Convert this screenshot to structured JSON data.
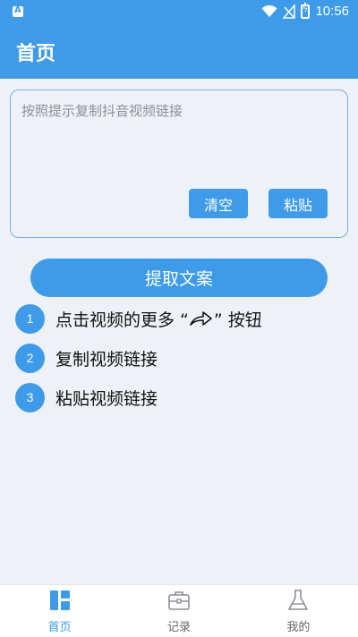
{
  "status_bar": {
    "time": "10:56",
    "app_icon": "A"
  },
  "app_bar": {
    "title": "首页"
  },
  "input": {
    "placeholder": "按照提示复制抖音视频链接",
    "value": ""
  },
  "buttons": {
    "clear": "清空",
    "paste": "粘贴",
    "extract": "提取文案"
  },
  "steps": [
    {
      "number": "1",
      "text_before": "点击视频的更多 “",
      "icon": "share-arrow-icon",
      "text_after": "” 按钮"
    },
    {
      "number": "2",
      "text": "复制视频链接"
    },
    {
      "number": "3",
      "text": "粘贴视频链接"
    }
  ],
  "bottom_nav": {
    "items": [
      {
        "label": "首页",
        "icon": "home-grid-icon",
        "active": true
      },
      {
        "label": "记录",
        "icon": "briefcase-icon",
        "active": false
      },
      {
        "label": "我的",
        "icon": "flask-icon",
        "active": false
      }
    ]
  },
  "colors": {
    "primary": "#3d9be9",
    "background": "#eef2f8",
    "nav_inactive": "#666666"
  }
}
